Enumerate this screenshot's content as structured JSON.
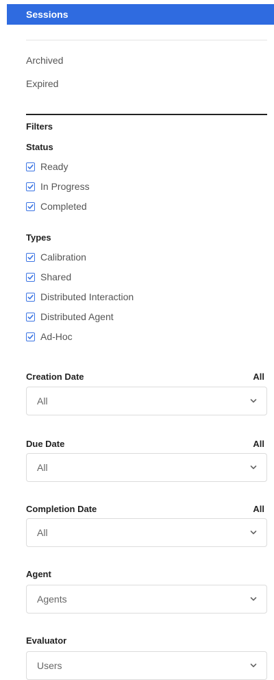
{
  "header": {
    "title": "Sessions"
  },
  "nav": {
    "archived": "Archived",
    "expired": "Expired"
  },
  "filters": {
    "title": "Filters",
    "status": {
      "label": "Status",
      "items": [
        {
          "label": "Ready",
          "checked": true
        },
        {
          "label": "In Progress",
          "checked": true
        },
        {
          "label": "Completed",
          "checked": true
        }
      ]
    },
    "types": {
      "label": "Types",
      "items": [
        {
          "label": "Calibration",
          "checked": true
        },
        {
          "label": "Shared",
          "checked": true
        },
        {
          "label": "Distributed Interaction",
          "checked": true
        },
        {
          "label": "Distributed Agent",
          "checked": true
        },
        {
          "label": "Ad-Hoc",
          "checked": true
        }
      ]
    },
    "creation_date": {
      "label": "Creation Date",
      "value": "All",
      "selected": "All"
    },
    "due_date": {
      "label": "Due Date",
      "value": "All",
      "selected": "All"
    },
    "completion_date": {
      "label": "Completion Date",
      "value": "All",
      "selected": "All"
    },
    "agent": {
      "label": "Agent",
      "selected": "Agents"
    },
    "evaluator": {
      "label": "Evaluator",
      "selected": "Users"
    }
  },
  "colors": {
    "header_bg": "#2f6be0",
    "checkbox_accent": "#3b74e3"
  },
  "icons": {
    "checkbox": "check-icon",
    "dropdown": "chevron-down-icon"
  }
}
